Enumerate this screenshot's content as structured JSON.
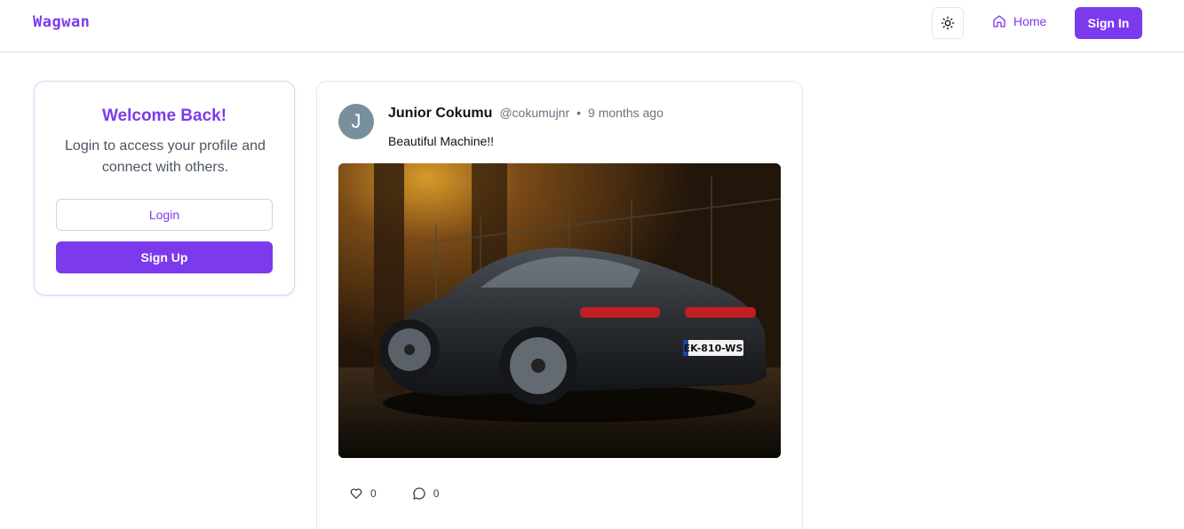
{
  "nav": {
    "logo": "Wagwan",
    "theme_icon": "sun-icon",
    "home_icon": "home-icon",
    "home_label": "Home",
    "signin_label": "Sign In"
  },
  "welcome": {
    "title": "Welcome Back!",
    "subtitle": "Login to access your profile and connect with others.",
    "login_label": "Login",
    "signup_label": "Sign Up"
  },
  "post": {
    "avatar_initial": "J",
    "author_name": "Junior Cokumu",
    "author_handle": "@cokumujnr",
    "separator": "•",
    "time": "9 months ago",
    "text": "Beautiful Machine!!",
    "image_plate": "EK-810-WS",
    "likes_count": "0",
    "comments_count": "0",
    "like_icon": "heart-icon",
    "comment_icon": "comment-icon"
  },
  "colors": {
    "accent": "#7c3aed",
    "border": "#ddd6f3",
    "avatar_bg": "#78909c"
  }
}
